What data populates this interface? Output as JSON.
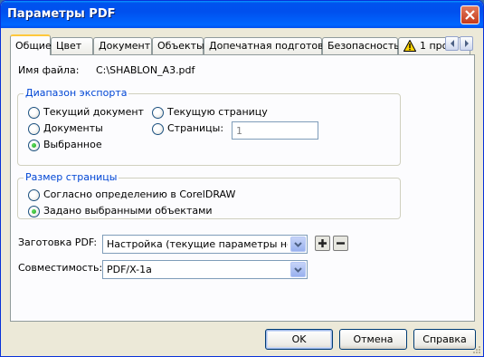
{
  "window": {
    "title": "Параметры PDF"
  },
  "tabs": [
    {
      "label": "Общие",
      "active": true
    },
    {
      "label": "Цвет"
    },
    {
      "label": "Документ"
    },
    {
      "label": "Объекты"
    },
    {
      "label": "Допечатная подготовка"
    },
    {
      "label": "Безопасность"
    },
    {
      "label": "1 про",
      "icon": "warning-icon"
    }
  ],
  "general": {
    "filename_label": "Имя файла:",
    "filename_value": "C:\\SHABLON_A3.pdf",
    "export_range": {
      "title": "Диапазон экспорта",
      "current_document": "Текущий документ",
      "documents": "Документы",
      "selection": "Выбранное",
      "current_page": "Текущую страницу",
      "pages": "Страницы:",
      "pages_value": "1",
      "selected": "selection"
    },
    "page_size": {
      "title": "Размер страницы",
      "as_defined": "Согласно определению в CorelDRAW",
      "by_objects": "Задано выбранными объектами",
      "selected": "by_objects"
    },
    "preset_label": "Заготовка PDF:",
    "preset_value": "Настройка (текущие параметры не с...",
    "compat_label": "Совместимость:",
    "compat_value": "PDF/X-1a"
  },
  "buttons": {
    "ok": "OK",
    "cancel": "Отмена",
    "help": "Справка"
  },
  "colors": {
    "title_bar": "#0053ee",
    "dialog_bg": "#ece9d8",
    "accent_tab": "#ffc83c",
    "group_title": "#0046d5"
  }
}
